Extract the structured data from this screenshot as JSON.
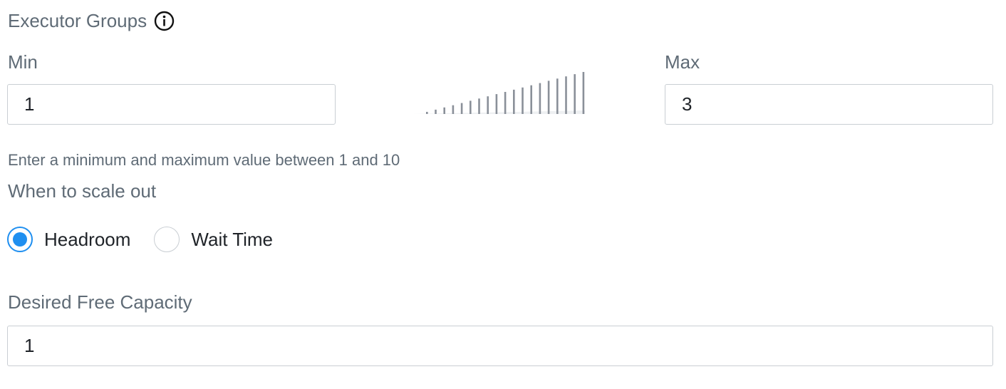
{
  "executor_groups": {
    "title": "Executor Groups",
    "info_icon": "info-circle-icon"
  },
  "min": {
    "label": "Min",
    "value": "1"
  },
  "max": {
    "label": "Max",
    "value": "3"
  },
  "scale_indicator": {
    "icon": "scale-bars-icon",
    "color": "#8a9099"
  },
  "help_text": "Enter a minimum and maximum value between 1 and 10",
  "scale_out": {
    "title": "When to scale out",
    "options": [
      {
        "label": "Headroom",
        "selected": true
      },
      {
        "label": "Wait Time",
        "selected": false
      }
    ]
  },
  "desired_free_capacity": {
    "label": "Desired Free Capacity",
    "value": "1"
  },
  "colors": {
    "accent": "#1f8ff0",
    "label_text": "#5f6b76",
    "input_border": "#c9ced3"
  }
}
